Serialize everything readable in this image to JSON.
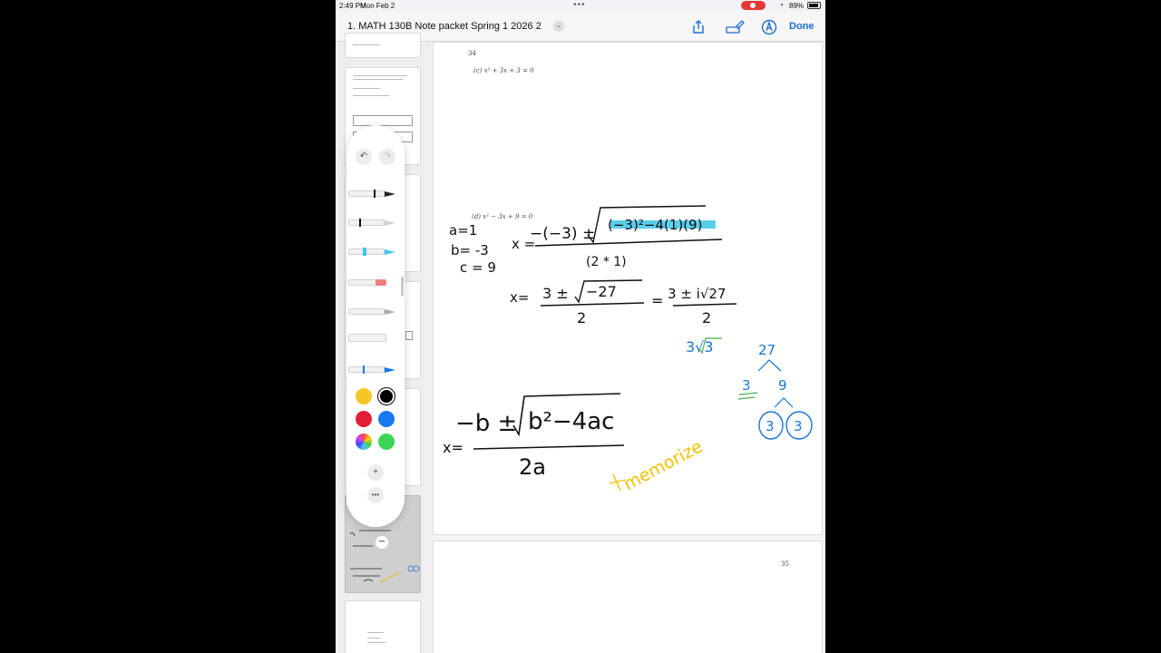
{
  "status": {
    "time": "2:49 PM",
    "date": "Mon Feb 2",
    "battery": "89%"
  },
  "nav": {
    "title": "1.  MATH 130B Note packet Spring 1 2026 2",
    "done": "Done"
  },
  "page34": {
    "page_number": "34",
    "problem_c": "(c)  x² + 3x + 3 = 0",
    "problem_d": "(d)  x² − 3x + 9 = 0"
  },
  "page35": {
    "page_number": "35"
  },
  "handwriting": {
    "a_eq": "a=1",
    "b_eq": "b= -3",
    "c_eq": "c = 9",
    "x_eq": "x =",
    "numerator1": "−(−3) ±",
    "radicand1": "(−3)²−4(1)(9)",
    "denominator1": "(2 * 1)",
    "x_eq2": "x=",
    "numerator2": "3 ±",
    "radicand2": "−27",
    "denominator2": "2",
    "equals": "=",
    "numerator3": "3 ± i√27",
    "denominator3": "2",
    "three_root_three": "3√3",
    "tree_top": "27",
    "tree_left": "3",
    "tree_right": "9",
    "tree_leaf1": "3",
    "tree_leaf2": "3",
    "formula_x": "x=",
    "formula_num": "−b ±",
    "formula_rad": "b²−4ac",
    "formula_den": "2a",
    "memorize": "memorize"
  },
  "colors": {
    "accent": "#1f6fd1",
    "ink_black": "#111111",
    "ink_blue": "#1976d2",
    "ink_green": "#4caf50",
    "ink_yellow": "#f2c200",
    "highlight": "#3ec6e8",
    "swatch_yellow": "#f6c623",
    "swatch_black": "#000000",
    "swatch_red": "#e01e37",
    "swatch_blue": "#1877f2",
    "swatch_green": "#3cd457"
  }
}
